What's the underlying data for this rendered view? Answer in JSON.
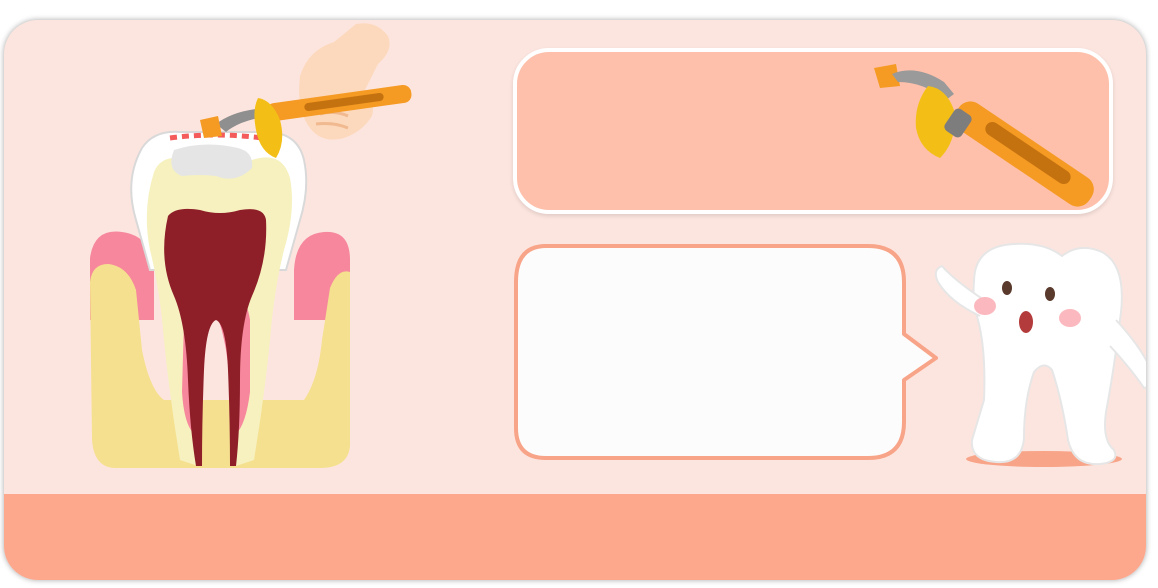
{
  "illustration": {
    "title": "",
    "colors": {
      "background_card": "#fde5df",
      "footer_band": "#fda88d",
      "top_panel": "#fec0ab",
      "bubble_fill": "#fcfcfc",
      "bubble_border": "#f8a488",
      "gum_pink": "#f6879c",
      "bone": "#f5e08f",
      "dentin": "#f6f1bf",
      "pulp": "#8e1f29",
      "curing_light_orange": "#f59a23",
      "curing_light_yellow": "#f3bf17"
    },
    "icons": [
      "tooth-cross-section-icon",
      "curing-light-icon",
      "hand-icon",
      "tooth-mascot-icon"
    ]
  },
  "top_panel": {
    "text": ""
  },
  "speech_bubble": {
    "text": ""
  },
  "footer": {
    "text": ""
  }
}
